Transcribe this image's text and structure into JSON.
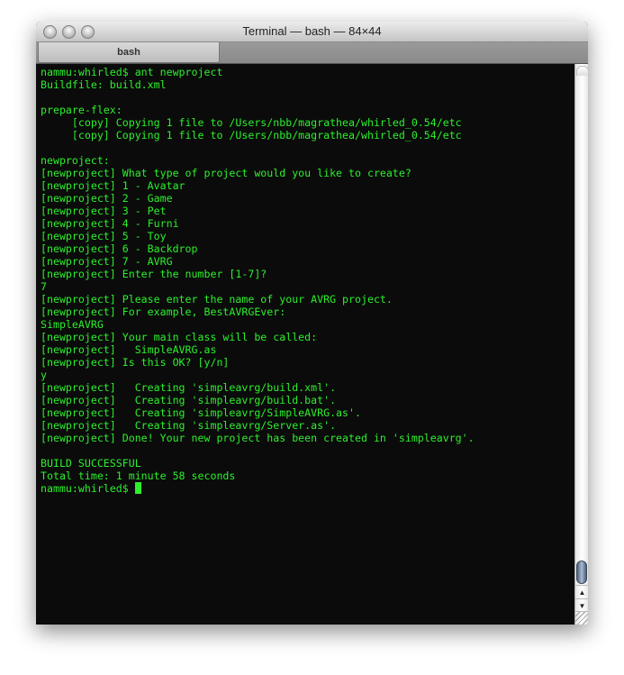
{
  "window": {
    "title": "Terminal — bash — 84×44",
    "tab_label": "bash"
  },
  "terminal": {
    "lines": [
      "nammu:whirled$ ant newproject",
      "Buildfile: build.xml",
      "",
      "prepare-flex:",
      "     [copy] Copying 1 file to /Users/nbb/magrathea/whirled_0.54/etc",
      "     [copy] Copying 1 file to /Users/nbb/magrathea/whirled_0.54/etc",
      "",
      "newproject:",
      "[newproject] What type of project would you like to create?",
      "[newproject] 1 - Avatar",
      "[newproject] 2 - Game",
      "[newproject] 3 - Pet",
      "[newproject] 4 - Furni",
      "[newproject] 5 - Toy",
      "[newproject] 6 - Backdrop",
      "[newproject] 7 - AVRG",
      "[newproject] Enter the number [1-7]?",
      "7",
      "[newproject] Please enter the name of your AVRG project.",
      "[newproject] For example, BestAVRGEver:",
      "SimpleAVRG",
      "[newproject] Your main class will be called:",
      "[newproject]   SimpleAVRG.as",
      "[newproject] Is this OK? [y/n]",
      "y",
      "[newproject]   Creating 'simpleavrg/build.xml'.",
      "[newproject]   Creating 'simpleavrg/build.bat'.",
      "[newproject]   Creating 'simpleavrg/SimpleAVRG.as'.",
      "[newproject]   Creating 'simpleavrg/Server.as'.",
      "[newproject] Done! Your new project has been created in 'simpleavrg'.",
      "",
      "BUILD SUCCESSFUL",
      "Total time: 1 minute 58 seconds"
    ],
    "prompt": "nammu:whirled$ ",
    "text_color": "#2cf02c",
    "background": "#0b0b0b"
  },
  "scrollbar": {
    "position": 1.0,
    "up_icon": "▲",
    "down_icon": "▼"
  }
}
